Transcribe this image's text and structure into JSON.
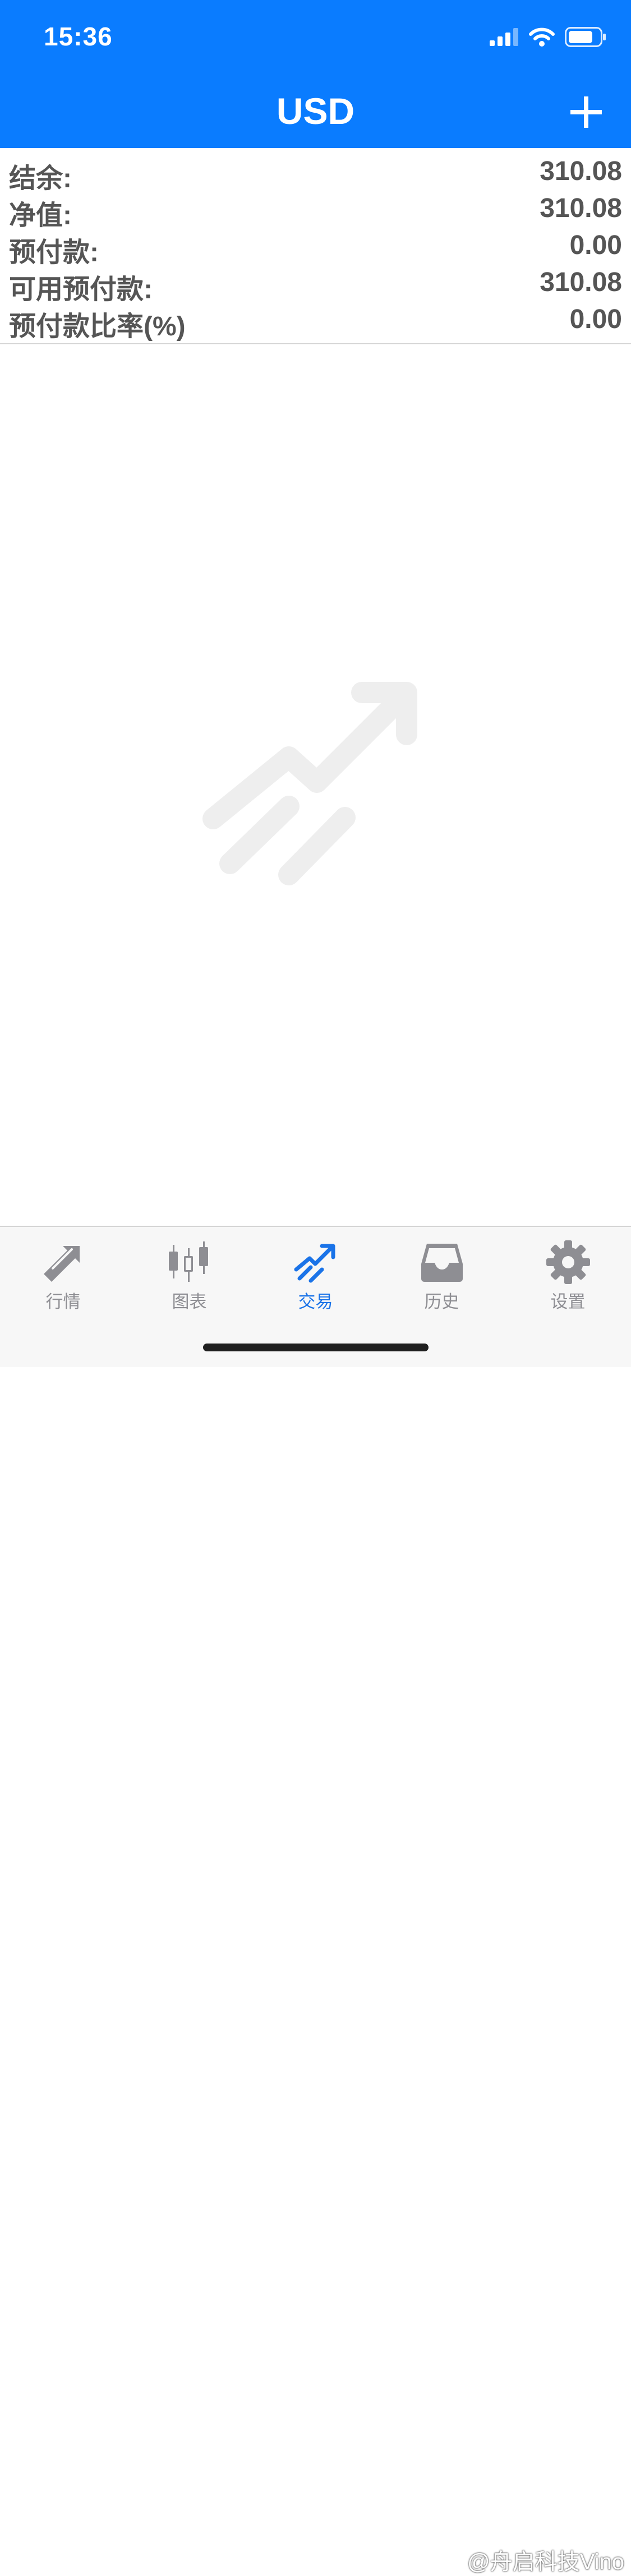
{
  "status_bar": {
    "time": "15:36",
    "signal_icon": "cellular-signal-icon",
    "wifi_icon": "wifi-icon",
    "battery_icon": "battery-icon"
  },
  "nav": {
    "title": "USD",
    "add_icon": "plus-icon"
  },
  "account": {
    "rows": [
      {
        "label": "结余:",
        "value": "310.08"
      },
      {
        "label": "净值:",
        "value": "310.08"
      },
      {
        "label": "预付款:",
        "value": "0.00"
      },
      {
        "label": "可用预付款:",
        "value": "310.08"
      },
      {
        "label": "预付款比率(%)",
        "value": "0.00"
      }
    ]
  },
  "empty_state": {
    "icon": "trade-trend-icon"
  },
  "tabs": [
    {
      "label": "行情",
      "icon": "quotes-icon",
      "active": false
    },
    {
      "label": "图表",
      "icon": "candlestick-chart-icon",
      "active": false
    },
    {
      "label": "交易",
      "icon": "trade-icon",
      "active": true
    },
    {
      "label": "历史",
      "icon": "history-inbox-icon",
      "active": false
    },
    {
      "label": "设置",
      "icon": "gear-icon",
      "active": false
    }
  ],
  "watermark": "@舟启科技Vino",
  "colors": {
    "header_bg": "#0a7cff",
    "tab_active": "#1a73e8",
    "tab_inactive": "#8e8e93",
    "text_gray": "#555555"
  }
}
